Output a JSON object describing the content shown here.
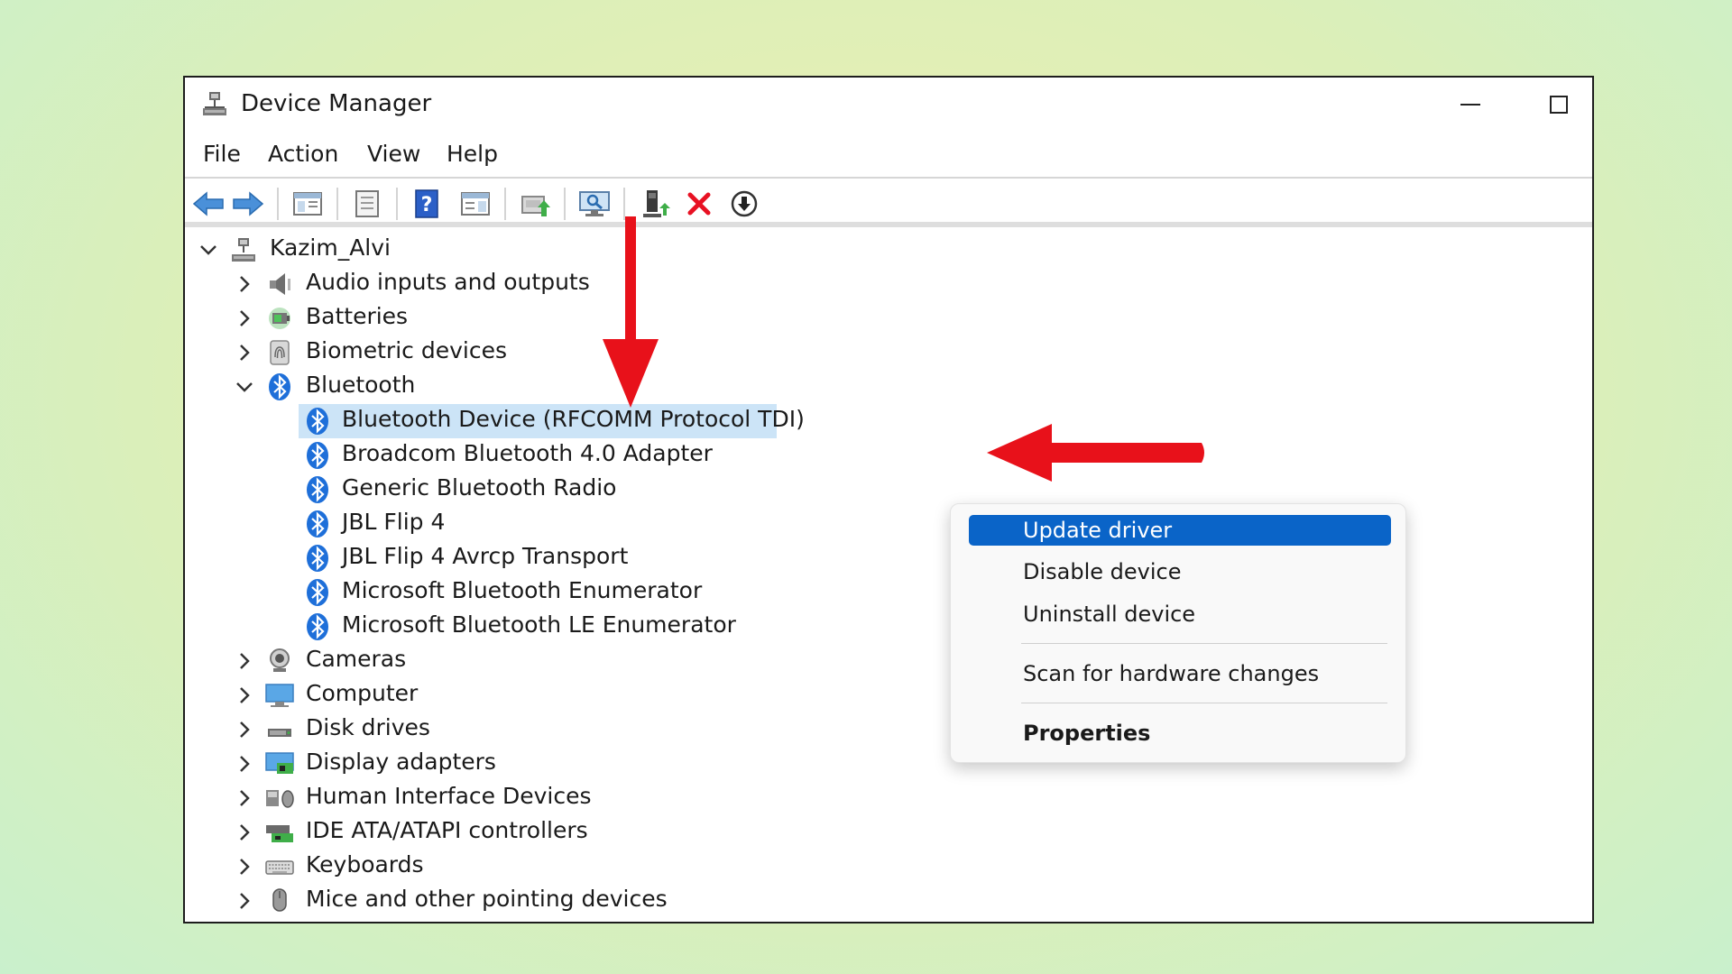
{
  "window": {
    "title": "Device Manager",
    "app_icon": "device-manager-icon",
    "controls": {
      "minimize": "minimize-icon",
      "maximize": "maximize-icon"
    }
  },
  "menubar": {
    "items": [
      "File",
      "Action",
      "View",
      "Help"
    ]
  },
  "toolbar": {
    "icons": [
      "back-arrow-icon",
      "forward-arrow-icon",
      "show-hide-console-tree-icon",
      "properties-icon",
      "help-icon",
      "action-pane-icon",
      "update-driver-icon",
      "scan-hardware-icon",
      "enable-device-icon",
      "uninstall-device-icon",
      "disable-device-icon"
    ],
    "accent_colors": {
      "back_forward": "#2f7fd1",
      "uninstall": "#e81123",
      "help": "#2b5fc7"
    }
  },
  "tree": {
    "root": {
      "label": "Kazim_Alvi",
      "expanded": true,
      "icon": "computer-tree-icon"
    },
    "categories": [
      {
        "label": "Audio inputs and outputs",
        "expanded": false,
        "icon": "speaker-icon"
      },
      {
        "label": "Batteries",
        "expanded": false,
        "icon": "battery-icon"
      },
      {
        "label": "Biometric devices",
        "expanded": false,
        "icon": "fingerprint-icon"
      },
      {
        "label": "Bluetooth",
        "expanded": true,
        "icon": "bluetooth-icon"
      },
      {
        "label": "Cameras",
        "expanded": false,
        "icon": "camera-icon"
      },
      {
        "label": "Computer",
        "expanded": false,
        "icon": "monitor-icon"
      },
      {
        "label": "Disk drives",
        "expanded": false,
        "icon": "disk-drive-icon"
      },
      {
        "label": "Display adapters",
        "expanded": false,
        "icon": "display-adapter-icon"
      },
      {
        "label": "Human Interface Devices",
        "expanded": false,
        "icon": "hid-icon"
      },
      {
        "label": "IDE ATA/ATAPI controllers",
        "expanded": false,
        "icon": "ide-controller-icon"
      },
      {
        "label": "Keyboards",
        "expanded": false,
        "icon": "keyboard-icon"
      },
      {
        "label": "Mice and other pointing devices",
        "expanded": false,
        "icon": "mouse-icon"
      }
    ],
    "bluetooth_devices": [
      {
        "label": "Bluetooth Device (RFCOMM Protocol TDI)",
        "selected": true
      },
      {
        "label": "Broadcom Bluetooth 4.0 Adapter"
      },
      {
        "label": "Generic Bluetooth Radio"
      },
      {
        "label": "JBL Flip 4"
      },
      {
        "label": "JBL Flip 4 Avrcp Transport"
      },
      {
        "label": "Microsoft Bluetooth Enumerator"
      },
      {
        "label": "Microsoft Bluetooth LE Enumerator"
      }
    ],
    "colors": {
      "selection": "#cce4f7",
      "bluetooth": "#1e6fd9"
    }
  },
  "context_menu": {
    "items": [
      {
        "label": "Update driver",
        "highlighted": true
      },
      {
        "label": "Disable device"
      },
      {
        "label": "Uninstall device"
      },
      {
        "label": "Scan for hardware changes"
      },
      {
        "label": "Properties",
        "bold": true
      }
    ],
    "highlight_color": "#0a64c8"
  },
  "annotations": {
    "arrow_color": "#e8111a",
    "arrows": [
      "down-arrow-annotation",
      "left-arrow-annotation"
    ]
  }
}
